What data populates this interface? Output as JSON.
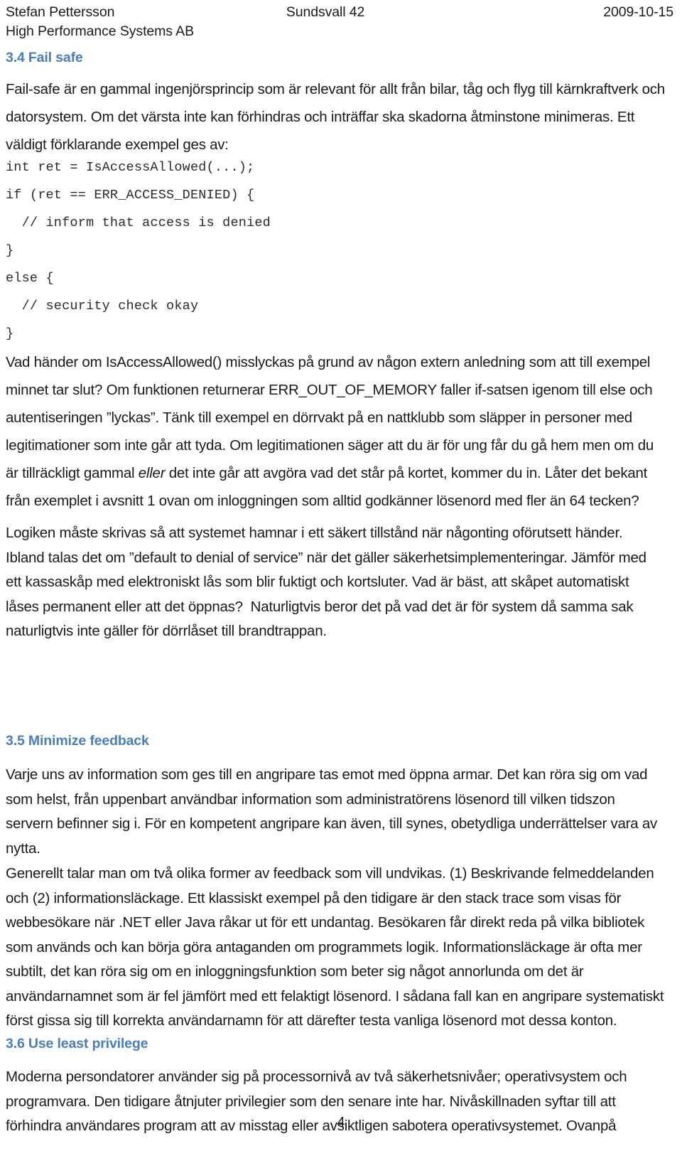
{
  "header": {
    "author": "Stefan Pettersson",
    "location": "Sundsvall 42",
    "date": "2009-10-15",
    "company": "High Performance Systems AB"
  },
  "theme": {
    "heading_color": "#4a7ebb",
    "body_color": "#1a1a1a",
    "code_color": "#2b2b2b",
    "page_background": "#ffffff"
  },
  "sections": {
    "fail_safe": {
      "heading": "3.4 Fail safe",
      "intro": "Fail-safe är en gammal ingenjörsprincip som är relevant för allt från bilar, tåg och flyg till kärnkraftverk och datorsystem. Om det värsta inte kan förhindras och inträffar ska skadorna åtminstone minimeras. Ett väldigt förklarande exempel ges av:",
      "code": "int ret = IsAccessAllowed(...);\nif (ret == ERR_ACCESS_DENIED) {\n  // inform that access is denied\n}\nelse {\n  // security check okay\n}",
      "para_1a": "Vad händer om IsAccessAllowed() misslyckas på grund av någon extern anledning som att till exempel minnet tar slut? Om funktionen returnerar ERR_OUT_OF_MEMORY faller if-satsen igenom till else och autentiseringen ”lyckas”. Tänk till exempel en dörrvakt på en nattklubb som släpper in personer med legitimationer som inte går att tyda. Om legitimationen säger att du är för ung får du gå hem men om du är tillräckligt gammal ",
      "para_1_italic": "eller",
      "para_1b": " det inte går att avgöra vad det står på kortet, kommer du in. Låter det bekant från exemplet i avsnitt 1 ovan om inloggningen som alltid godkänner lösenord med fler än 64 tecken?",
      "para_2": "Logiken måste skrivas så att systemet hamnar i ett säkert tillstånd när någonting oförutsett händer. Ibland talas det om ”default to denial of service” när det gäller säkerhetsimplementeringar. Jämför med ett kassaskåp med elektroniskt lås som blir fuktigt och kortsluter. Vad är bäst, att skåpet automatiskt låses permanent eller att det öppnas?  Naturligtvis beror det på vad det är för system då samma sak naturligtvis inte gäller för dörrlåset till brandtrappan."
    },
    "minimize_feedback": {
      "heading": "3.5 Minimize feedback",
      "para_1": "Varje uns av information som ges till en angripare tas emot med öppna armar. Det kan röra sig om vad som helst, från uppenbart användbar information som administratörens lösenord till vilken tidszon servern befinner sig i. För en kompetent angripare kan även, till synes, obetydliga underrättelser vara av nytta.",
      "para_2": "Generellt talar man om två olika former av feedback som vill undvikas. (1) Beskrivande felmeddelanden och (2) informationsläckage. Ett klassiskt exempel på den tidigare är den stack trace som visas för webbesökare när .NET eller Java råkar ut för ett undantag. Besökaren får direkt reda på vilka bibliotek som används och kan börja göra antaganden om programmets logik. Informationsläckage är ofta mer subtilt, det kan röra sig om en inloggningsfunktion som beter sig något annorlunda om det är användarnamnet som är fel jämfört med ett felaktigt lösenord. I sådana fall kan en angripare systematiskt först gissa sig till korrekta användarnamn för att därefter testa vanliga lösenord mot dessa konton."
    },
    "least_privilege": {
      "heading": "3.6 Use least privilege",
      "para_1": "Moderna persondatorer använder sig på processornivå av två säkerhetsnivåer; operativsystem och programvara. Den tidigare åtnjuter privilegier som den senare inte har. Nivåskillnaden syftar till att förhindra användares program att av misstag eller avsiktligen sabotera operativsystemet. Ovanpå"
    }
  },
  "footer": {
    "page_number": "4"
  }
}
